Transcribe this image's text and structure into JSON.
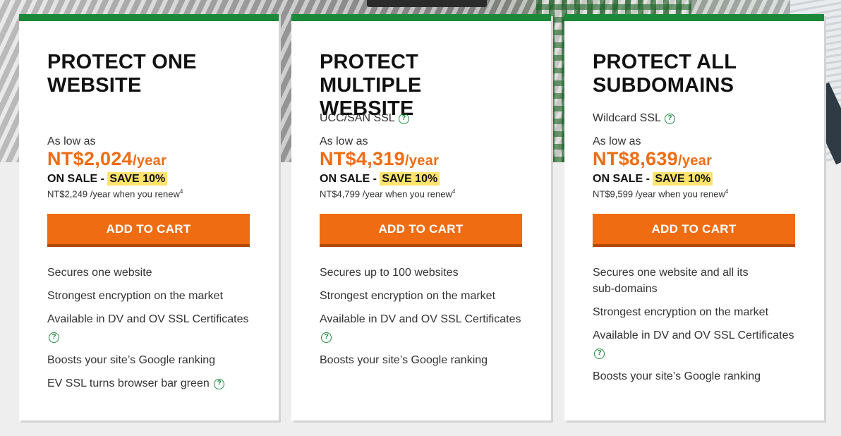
{
  "cards": [
    {
      "title_line1": "PROTECT ONE",
      "title_line2": "WEBSITE",
      "subtitle": "",
      "as_low_as": "As low as",
      "price": "NT$2,024",
      "per": "/year",
      "on_sale": "ON SALE - ",
      "save": "SAVE 10%",
      "renew": "NT$2,249 /year when you renew",
      "renew_sup": "4",
      "cart_label": "ADD TO CART",
      "features": [
        "Secures one website",
        "Strongest encryption on the market",
        "Available in DV and OV SSL Certificates",
        "Boosts your site’s Google ranking",
        "EV SSL turns browser bar green"
      ]
    },
    {
      "title_line1": "PROTECT MULTIPLE",
      "title_line2": "WEBSITE",
      "subtitle": "UCC/SAN SSL",
      "as_low_as": "As low as",
      "price": "NT$4,319",
      "per": "/year",
      "on_sale": "ON SALE - ",
      "save": "SAVE 10%",
      "renew": "NT$4,799 /year when you renew",
      "renew_sup": "4",
      "cart_label": "ADD TO CART",
      "features": [
        "Secures up to 100 websites",
        "Strongest encryption on the market",
        "Available in DV and OV SSL Certificates",
        "Boosts your site’s Google ranking"
      ]
    },
    {
      "title_line1": "PROTECT ALL",
      "title_line2": "SUBDOMAINS",
      "subtitle": "Wildcard SSL",
      "as_low_as": "As low as",
      "price": "NT$8,639",
      "per": "/year",
      "on_sale": "ON SALE - ",
      "save": "SAVE 10%",
      "renew": "NT$9,599 /year when you renew",
      "renew_sup": "4",
      "cart_label": "ADD TO CART",
      "features": [
        "Secures one website and all its",
        "sub-domains",
        "Strongest encryption on the market",
        "Available in DV and OV SSL Certificates",
        "Boosts your site’s Google ranking"
      ]
    }
  ],
  "icons": {
    "help": "question-circle-icon",
    "help_glyph": "?"
  },
  "colors": {
    "accent_green": "#1a8a3a",
    "price_orange": "#ef6c13",
    "button_orange": "#ef6c13",
    "save_highlight": "#ffe36e"
  }
}
